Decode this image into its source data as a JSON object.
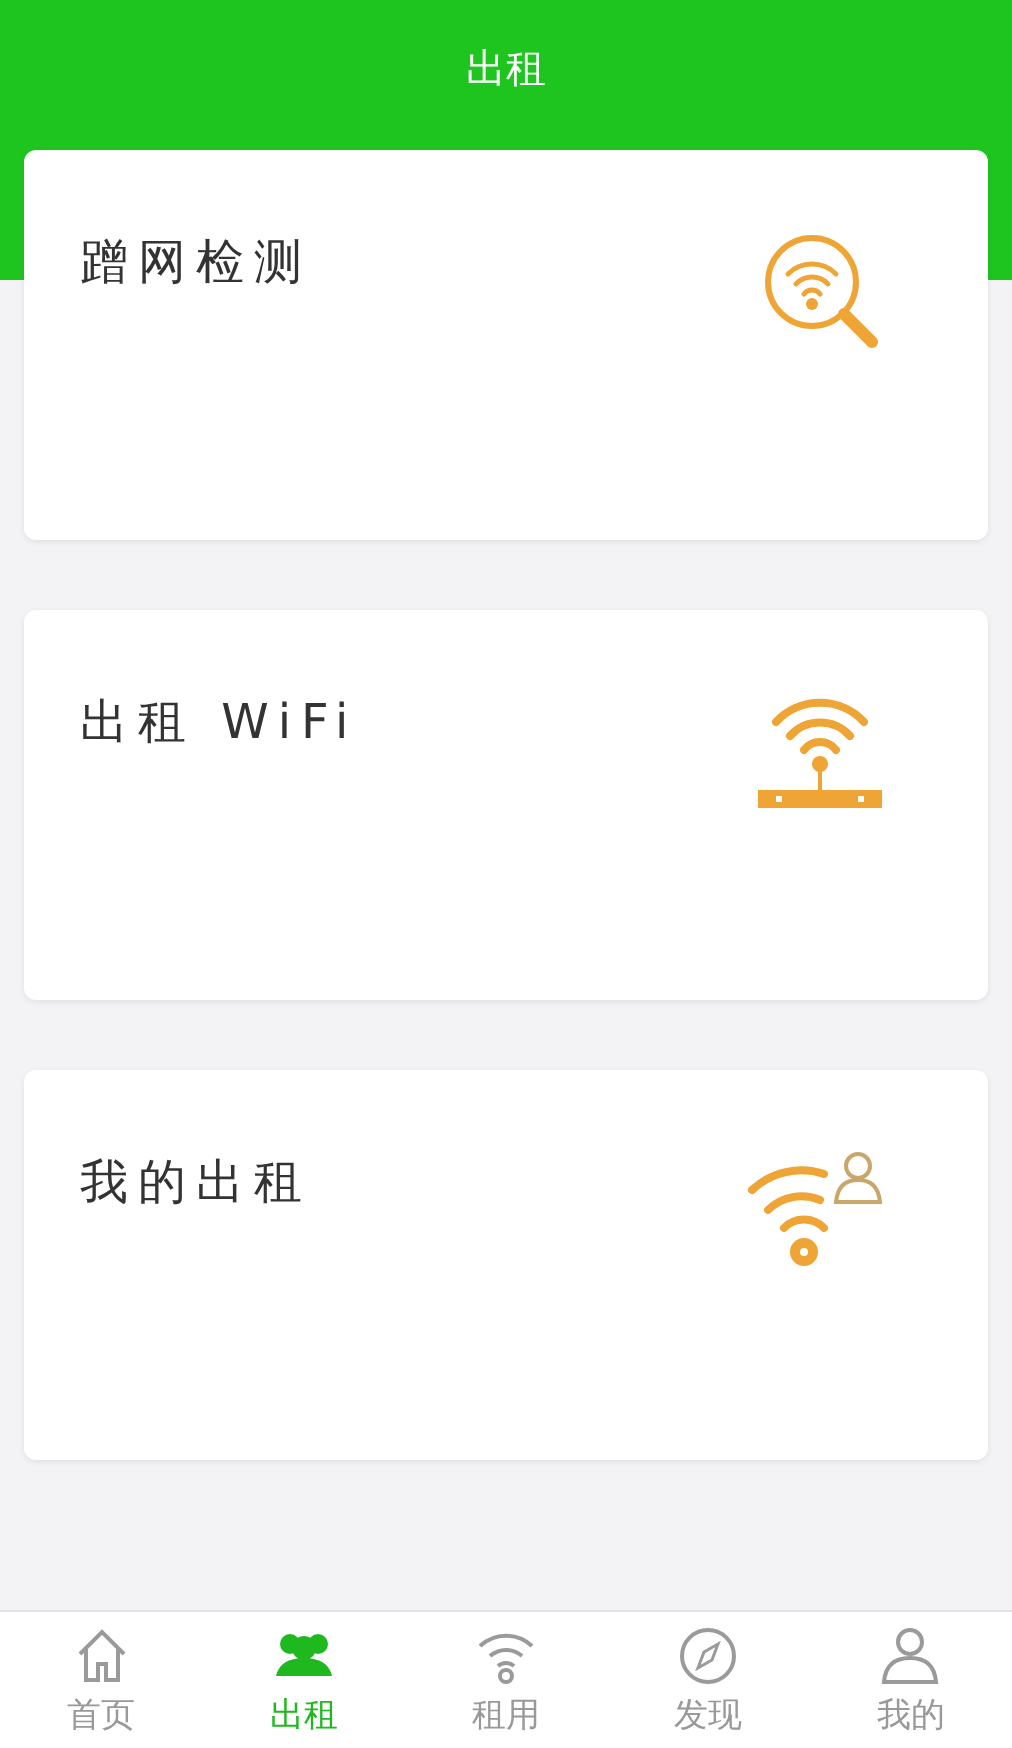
{
  "header": {
    "title": "出租"
  },
  "cards": [
    {
      "label": "蹭网检测"
    },
    {
      "label": "出租 WiFi"
    },
    {
      "label": "我的出租"
    }
  ],
  "tabs": [
    {
      "label": "首页",
      "selected": false
    },
    {
      "label": "出租",
      "selected": true
    },
    {
      "label": "租用",
      "selected": false
    },
    {
      "label": "发现",
      "selected": false
    },
    {
      "label": "我的",
      "selected": false
    }
  ]
}
